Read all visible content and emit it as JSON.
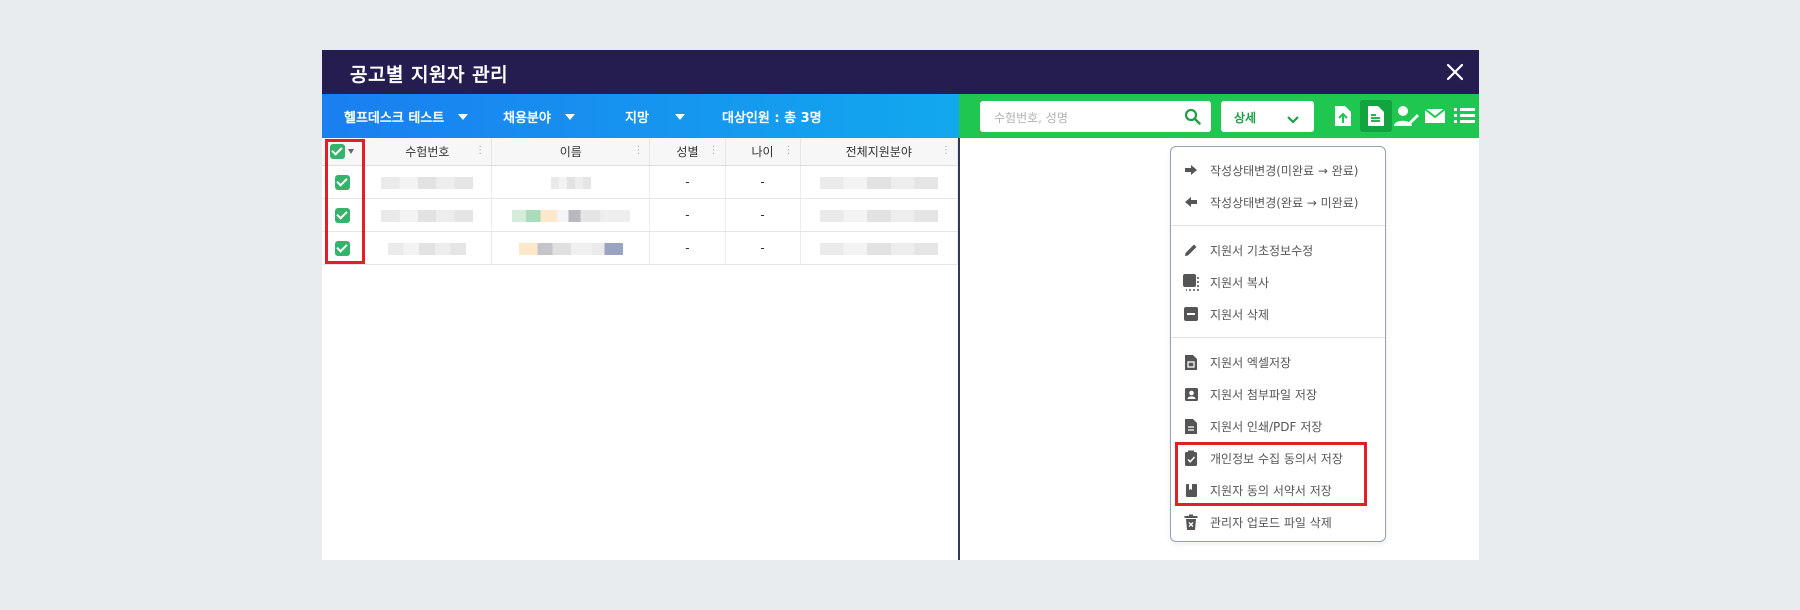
{
  "window": {
    "title": "공고별 지원자 관리"
  },
  "filters": {
    "job_posting": "헬프데스크 테스트",
    "field": "채용분야",
    "preference": "지망",
    "target_count": "대상인원 : 총 3명"
  },
  "search": {
    "placeholder": "수험번호, 성명",
    "value": ""
  },
  "detail_dropdown": {
    "selected": "상세"
  },
  "toolbar_icons": [
    "upload-file-icon",
    "document-icon",
    "user-edit-icon",
    "mail-icon",
    "list-icon"
  ],
  "table": {
    "columns": [
      "수험번호",
      "이름",
      "성별",
      "나이",
      "전체지원분야"
    ],
    "rows": [
      {
        "gender": "-",
        "age": "-"
      },
      {
        "gender": "-",
        "age": "-"
      },
      {
        "gender": "-",
        "age": "-"
      }
    ]
  },
  "menu": {
    "items": [
      {
        "icon": "arrow-right-icon",
        "label": "작성상태변경(미완료 → 완료)"
      },
      {
        "icon": "arrow-left-icon",
        "label": "작성상태변경(완료 → 미완료)"
      },
      {
        "icon": "pencil-icon",
        "label": "지원서 기초정보수정"
      },
      {
        "icon": "copy-icon",
        "label": "지원서 복사"
      },
      {
        "icon": "minus-box-icon",
        "label": "지원서 삭제"
      },
      {
        "icon": "excel-file-icon",
        "label": "지원서 엑셀저장"
      },
      {
        "icon": "attachment-user-icon",
        "label": "지원서 첨부파일 저장"
      },
      {
        "icon": "print-file-icon",
        "label": "지원서 인쇄/PDF 저장"
      },
      {
        "icon": "clipboard-check-icon",
        "label": "개인정보 수집 동의서 저장"
      },
      {
        "icon": "book-icon",
        "label": "지원자 동의 서약서 저장"
      },
      {
        "icon": "trash-icon",
        "label": "관리자 업로드 파일 삭제"
      }
    ]
  },
  "colors": {
    "title_bar": "#251c4f",
    "filter_bar": "#1a7ff0",
    "action_bar": "#1fc650",
    "highlight": "#e31e24"
  }
}
